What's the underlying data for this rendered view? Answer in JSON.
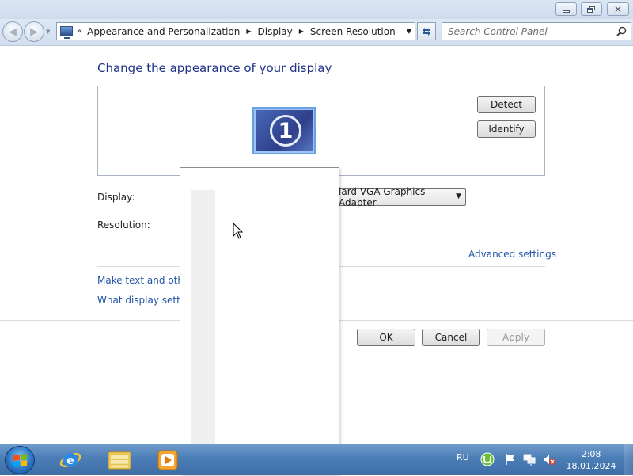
{
  "window": {
    "caption_buttons": {
      "minimize": "minimize-icon",
      "maximize": "restore-icon",
      "close": "close-icon"
    }
  },
  "nav": {
    "back_icon": "back-arrow-icon",
    "forward_icon": "forward-arrow-icon",
    "breadcrumb": [
      "Appearance and Personalization",
      "Display",
      "Screen Resolution"
    ],
    "overflow_marker": "«",
    "search_placeholder": "Search Control Panel"
  },
  "main": {
    "title": "Change the appearance of your display",
    "monitor_number": "1",
    "detect_label": "Detect",
    "identify_label": "Identify",
    "display_label": "Display:",
    "display_value_visible": "lard VGA Graphics Adapter",
    "resolution_label": "Resolution:",
    "advanced_link": "Advanced settings",
    "link_text_size": "Make text and other",
    "link_display_settings": "What display setting",
    "ok_label": "OK",
    "cancel_label": "Cancel",
    "apply_label": "Apply"
  },
  "taskbar": {
    "apps": [
      "internet-explorer-icon",
      "windows-explorer-icon",
      "media-player-icon"
    ],
    "language": "RU",
    "tray_icons": [
      "utorrent-icon",
      "action-center-flag-icon",
      "network-icon",
      "volume-muted-icon"
    ],
    "time": "2:08",
    "date": "18.01.2024"
  },
  "colors": {
    "title_text": "#1e3287",
    "link": "#2054a6",
    "taskbar": "#4b7db6"
  }
}
